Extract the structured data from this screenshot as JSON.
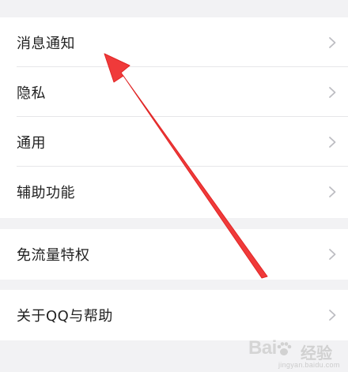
{
  "settings": {
    "group1": [
      {
        "label": "消息通知"
      },
      {
        "label": "隐私"
      },
      {
        "label": "通用"
      },
      {
        "label": "辅助功能"
      }
    ],
    "group2": [
      {
        "label": "免流量特权"
      }
    ],
    "group3": [
      {
        "label": "关于QQ与帮助"
      }
    ]
  },
  "icons": {
    "row_chevron": "chevron-right-icon",
    "annotation_arrow": "red-arrow-annotation",
    "watermark_paw": "baidu-paw-icon"
  },
  "colors": {
    "background": "#f2f2f4",
    "row_background": "#ffffff",
    "text": "#222222",
    "chevron": "#bdbdc2",
    "divider": "#e6e6e9",
    "annotation_arrow": "#f03a3a"
  },
  "watermark": {
    "logo_text": "Bai",
    "logo_suffix": "经验",
    "url": "jingyan.baidu.com"
  }
}
